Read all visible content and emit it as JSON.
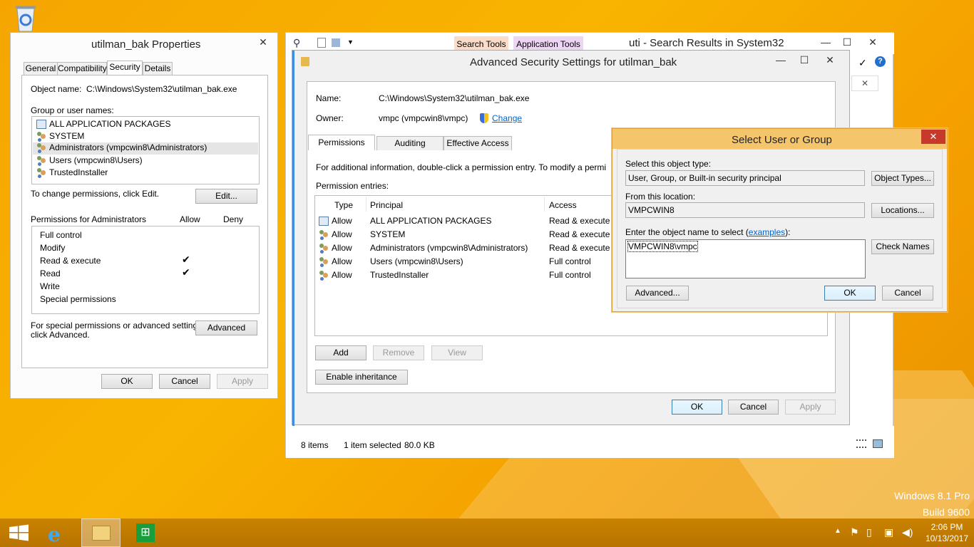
{
  "desktop": {
    "os_name": "Windows 8.1 Pro",
    "os_build": "Build 9600"
  },
  "props": {
    "title": "utilman_bak Properties",
    "tabs": [
      "General",
      "Compatibility",
      "Security",
      "Details"
    ],
    "object_name_label": "Object name:",
    "object_name_value": "C:\\Windows\\System32\\utilman_bak.exe",
    "group_label": "Group or user names:",
    "groups": [
      "ALL APPLICATION PACKAGES",
      "SYSTEM",
      "Administrators (vmpcwin8\\Administrators)",
      "Users (vmpcwin8\\Users)",
      "TrustedInstaller"
    ],
    "change_text": "To change permissions, click Edit.",
    "edit_label": "Edit...",
    "perms_for": "Permissions for Administrators",
    "allow_label": "Allow",
    "deny_label": "Deny",
    "perms": [
      "Full control",
      "Modify",
      "Read & execute",
      "Read",
      "Write",
      "Special permissions"
    ],
    "special_text_1": "For special permissions or advanced settings,",
    "special_text_2": "click Advanced.",
    "advanced_label": "Advanced",
    "ok": "OK",
    "cancel": "Cancel",
    "apply": "Apply"
  },
  "explorer": {
    "title": "uti - Search Results in System32",
    "search_tools": "Search Tools",
    "app_tools": "Application Tools",
    "status_items": "8 items",
    "status_selected": "1 item selected",
    "status_size": "80.0 KB"
  },
  "adv": {
    "title": "Advanced Security Settings for utilman_bak",
    "name_label": "Name:",
    "name_value": "C:\\Windows\\System32\\utilman_bak.exe",
    "owner_label": "Owner:",
    "owner_value": "vmpc (vmpcwin8\\vmpc)",
    "change_link": "Change",
    "tabs": [
      "Permissions",
      "Auditing",
      "Effective Access"
    ],
    "info_text": "For additional information, double-click a permission entry. To modify a permi",
    "entries_label": "Permission entries:",
    "col_type": "Type",
    "col_principal": "Principal",
    "col_access": "Access",
    "entries": [
      {
        "type": "Allow",
        "principal": "ALL APPLICATION PACKAGES",
        "access": "Read & execute"
      },
      {
        "type": "Allow",
        "principal": "SYSTEM",
        "access": "Read & execute"
      },
      {
        "type": "Allow",
        "principal": "Administrators (vmpcwin8\\Administrators)",
        "access": "Read & execute"
      },
      {
        "type": "Allow",
        "principal": "Users (vmpcwin8\\Users)",
        "access": "Full control"
      },
      {
        "type": "Allow",
        "principal": "TrustedInstaller",
        "access": "Full control"
      }
    ],
    "add": "Add",
    "remove": "Remove",
    "view": "View",
    "enable_inheritance": "Enable inheritance",
    "ok": "OK",
    "cancel": "Cancel",
    "apply": "Apply"
  },
  "select": {
    "title": "Select User or Group",
    "object_type_label": "Select this object type:",
    "object_type_value": "User, Group, or Built-in security principal",
    "object_types_btn": "Object Types...",
    "location_label": "From this location:",
    "location_value": "VMPCWIN8",
    "locations_btn": "Locations...",
    "enter_label_pre": "Enter the object name to select (",
    "enter_label_link": "examples",
    "enter_label_post": "):",
    "input_value": "VMPCWIN8\\vmpc",
    "check_names": "Check Names",
    "advanced": "Advanced...",
    "ok": "OK",
    "cancel": "Cancel"
  },
  "taskbar": {
    "time": "2:06 PM",
    "date": "10/13/2017"
  }
}
